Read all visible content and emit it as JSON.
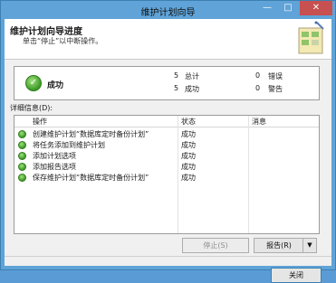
{
  "window": {
    "title": "维护计划向导"
  },
  "header": {
    "title": "维护计划向导进度",
    "subtitle": "单击“停止”以中断操作。"
  },
  "summary": {
    "status": "成功",
    "total_count": "5",
    "total_label": "总计",
    "success_count": "5",
    "success_label": "成功",
    "error_count": "0",
    "error_label": "错误",
    "warning_count": "0",
    "warning_label": "警告"
  },
  "details": {
    "label": "详细信息(D):",
    "columns": [
      "操作",
      "状态",
      "消息"
    ],
    "rows": [
      {
        "operation": "创建维护计划“数据库定时备份计划”",
        "status": "成功",
        "message": ""
      },
      {
        "operation": "将任务添加到维护计划",
        "status": "成功",
        "message": ""
      },
      {
        "operation": "添加计划选项",
        "status": "成功",
        "message": ""
      },
      {
        "operation": "添加报告选项",
        "status": "成功",
        "message": ""
      },
      {
        "operation": "保存维护计划“数据库定时备份计划”",
        "status": "成功",
        "message": ""
      }
    ]
  },
  "buttons": {
    "stop": "停止(S)",
    "report": "报告(R)",
    "report_arrow": "▼",
    "close": "关闭"
  },
  "icons": {
    "success": "checkmark-icon",
    "row_success": "success-dot-icon",
    "wizard": "wizard-illustration-icon"
  }
}
